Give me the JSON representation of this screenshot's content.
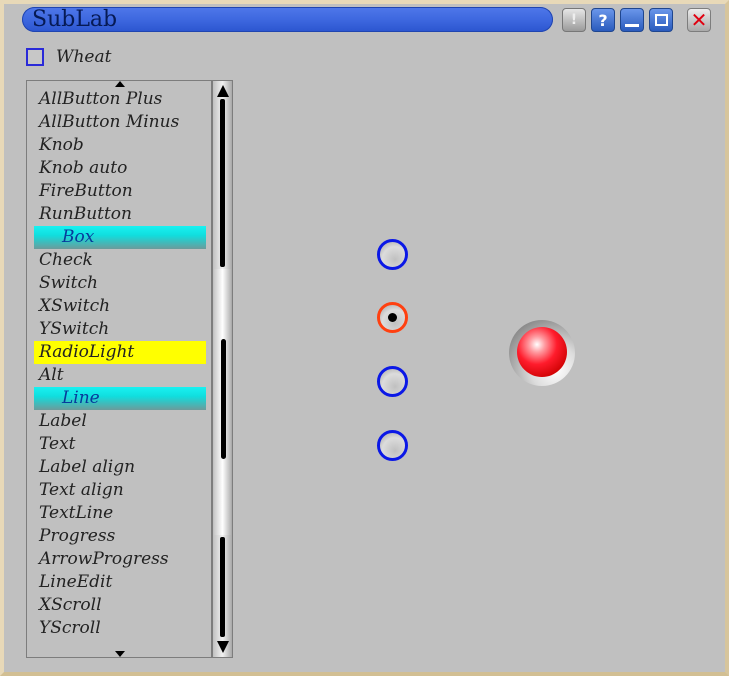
{
  "window": {
    "title": "SubLab",
    "buttons": {
      "info": "!",
      "help": "?"
    }
  },
  "checkbox": {
    "label": "Wheat",
    "checked": false
  },
  "list": {
    "items": [
      {
        "label": "AllButton Plus",
        "style": "normal"
      },
      {
        "label": "AllButton Minus",
        "style": "normal"
      },
      {
        "label": "Knob",
        "style": "normal"
      },
      {
        "label": "Knob auto",
        "style": "normal"
      },
      {
        "label": "FireButton",
        "style": "normal"
      },
      {
        "label": "RunButton",
        "style": "normal"
      },
      {
        "label": "Box",
        "style": "cyan"
      },
      {
        "label": "Check",
        "style": "normal"
      },
      {
        "label": "Switch",
        "style": "normal"
      },
      {
        "label": "XSwitch",
        "style": "normal"
      },
      {
        "label": "YSwitch",
        "style": "normal"
      },
      {
        "label": "RadioLight",
        "style": "yellow"
      },
      {
        "label": "Alt",
        "style": "normal"
      },
      {
        "label": "Line",
        "style": "cyan"
      },
      {
        "label": "Label",
        "style": "normal"
      },
      {
        "label": "Text",
        "style": "normal"
      },
      {
        "label": "Label align",
        "style": "normal"
      },
      {
        "label": "Text align",
        "style": "normal"
      },
      {
        "label": "TextLine",
        "style": "normal"
      },
      {
        "label": "Progress",
        "style": "normal"
      },
      {
        "label": "ArrowProgress",
        "style": "normal"
      },
      {
        "label": "LineEdit",
        "style": "normal"
      },
      {
        "label": "XScroll",
        "style": "normal"
      },
      {
        "label": "YScroll",
        "style": "normal"
      }
    ]
  },
  "radios": {
    "count": 4,
    "selected_index": 1
  },
  "light": {
    "state": "on",
    "color": "#ff1c2c"
  },
  "colors": {
    "title_bar": "#3c66de",
    "cyan_highlight": "#10dede",
    "yellow_highlight": "#ffff00",
    "radio_border": "#0b18e6",
    "radio_selected_border": "#ff4010"
  }
}
